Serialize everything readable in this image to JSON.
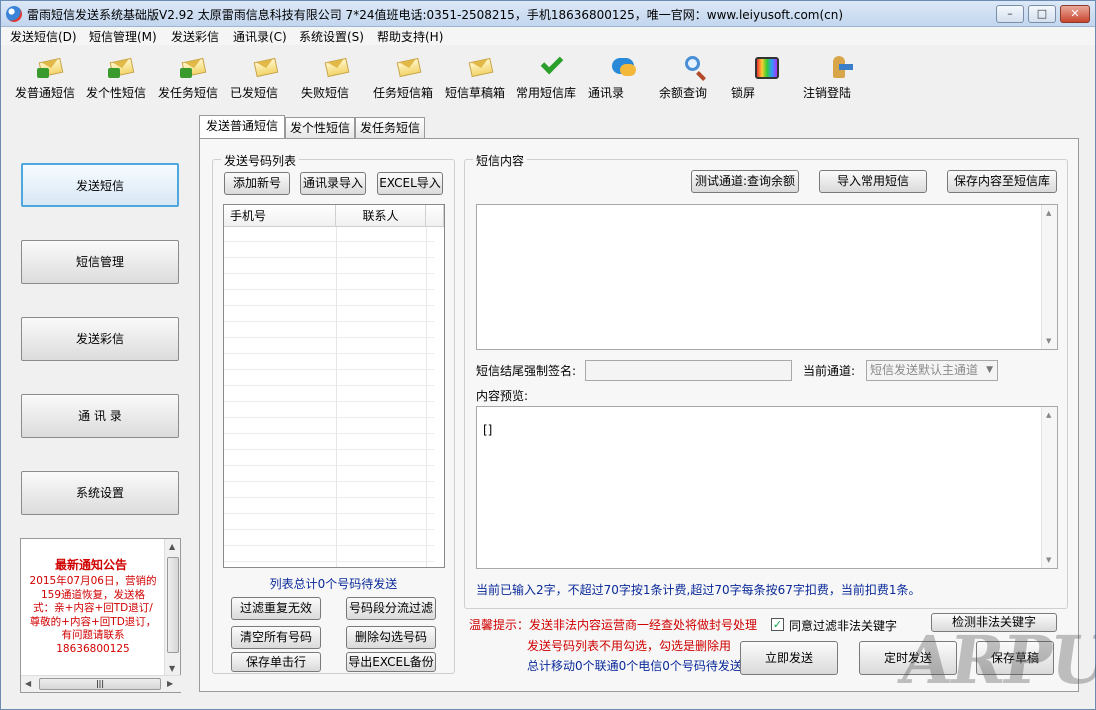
{
  "window": {
    "title": "雷雨短信发送系统基础版V2.92  太原雷雨信息科技有限公司  7*24值班电话:0351-2508215，手机18636800125，唯一官网：www.leiyusoft.com(cn)",
    "min": "–",
    "max": "□",
    "close": "✕"
  },
  "menu": [
    "发送短信(D)",
    "短信管理(M)",
    "发送彩信",
    "通讯录(C)",
    "系统设置(S)",
    "帮助支持(H)"
  ],
  "toolbar": [
    {
      "label": "发普通短信",
      "icon": "send-sms-icon"
    },
    {
      "label": "发个性短信",
      "icon": "send-personal-sms-icon"
    },
    {
      "label": "发任务短信",
      "icon": "send-task-sms-icon"
    },
    {
      "label": "已发短信",
      "icon": "sent-sms-icon"
    },
    {
      "label": "失败短信",
      "icon": "failed-sms-icon"
    },
    {
      "label": "任务短信箱",
      "icon": "task-box-icon"
    },
    {
      "label": "短信草稿箱",
      "icon": "drafts-icon"
    },
    {
      "label": "常用短信库",
      "icon": "check-icon"
    },
    {
      "label": "通讯录",
      "icon": "contacts-chat-icon"
    },
    {
      "label": "余额查询",
      "icon": "magnifier-icon"
    },
    {
      "label": "锁屏",
      "icon": "tv-lock-icon"
    },
    {
      "label": "注销登陆",
      "icon": "logout-person-icon"
    }
  ],
  "nav": [
    "发送短信",
    "短信管理",
    "发送彩信",
    "通 讯 录",
    "系统设置"
  ],
  "notice": {
    "title": "最新通知公告",
    "lines": [
      "2015年07月06日，营销的",
      "159通道恢复，发送格",
      "式：亲+内容+回TD退订/",
      "尊敬的+内容+回TD退订，",
      "有问题请联系",
      "18636800125"
    ]
  },
  "tabs": [
    "发送普通短信",
    "发个性短信",
    "发任务短信"
  ],
  "numbers": {
    "group_title": "发送号码列表",
    "btn_add": "添加新号",
    "btn_import_contacts": "通讯录导入",
    "btn_import_excel": "EXCEL导入",
    "col_phone": "手机号",
    "col_name": "联系人",
    "total": "列表总计0个号码待发送",
    "btn_filter_dup": "过滤重复无效",
    "btn_split": "号码段分流过滤",
    "btn_clear": "清空所有号码",
    "btn_delete_checked": "删除勾选号码",
    "btn_save_row": "保存单击行",
    "btn_export": "导出EXCEL备份"
  },
  "content": {
    "group_title": "短信内容",
    "btn_test": "测试通道:查询余额",
    "btn_import_common": "导入常用短信",
    "btn_save_lib": "保存内容至短信库",
    "sign_label": "短信结尾强制签名:",
    "channel_label": "当前通道:",
    "channel_value": "短信发送默认主通道",
    "preview_label": "内容预览:",
    "preview_text": "[]",
    "count_info": "当前已输入2字，不超过70字按1条计费,超过70字每条按67字扣费，当前扣费1条。"
  },
  "footer": {
    "warn": "温馨提示：发送非法内容运营商一经查处将做封号处理",
    "tip": "发送号码列表不用勾选，勾选是删除用",
    "stat": "总计移动0个联通0个电信0个号码待发送",
    "filter_label": "同意过滤非法关键字",
    "btn_check": "检测非法关键字",
    "btn_send_now": "立即发送",
    "btn_timed": "定时发送",
    "btn_save_draft": "保存草稿"
  },
  "watermark": "ARPUN.com"
}
